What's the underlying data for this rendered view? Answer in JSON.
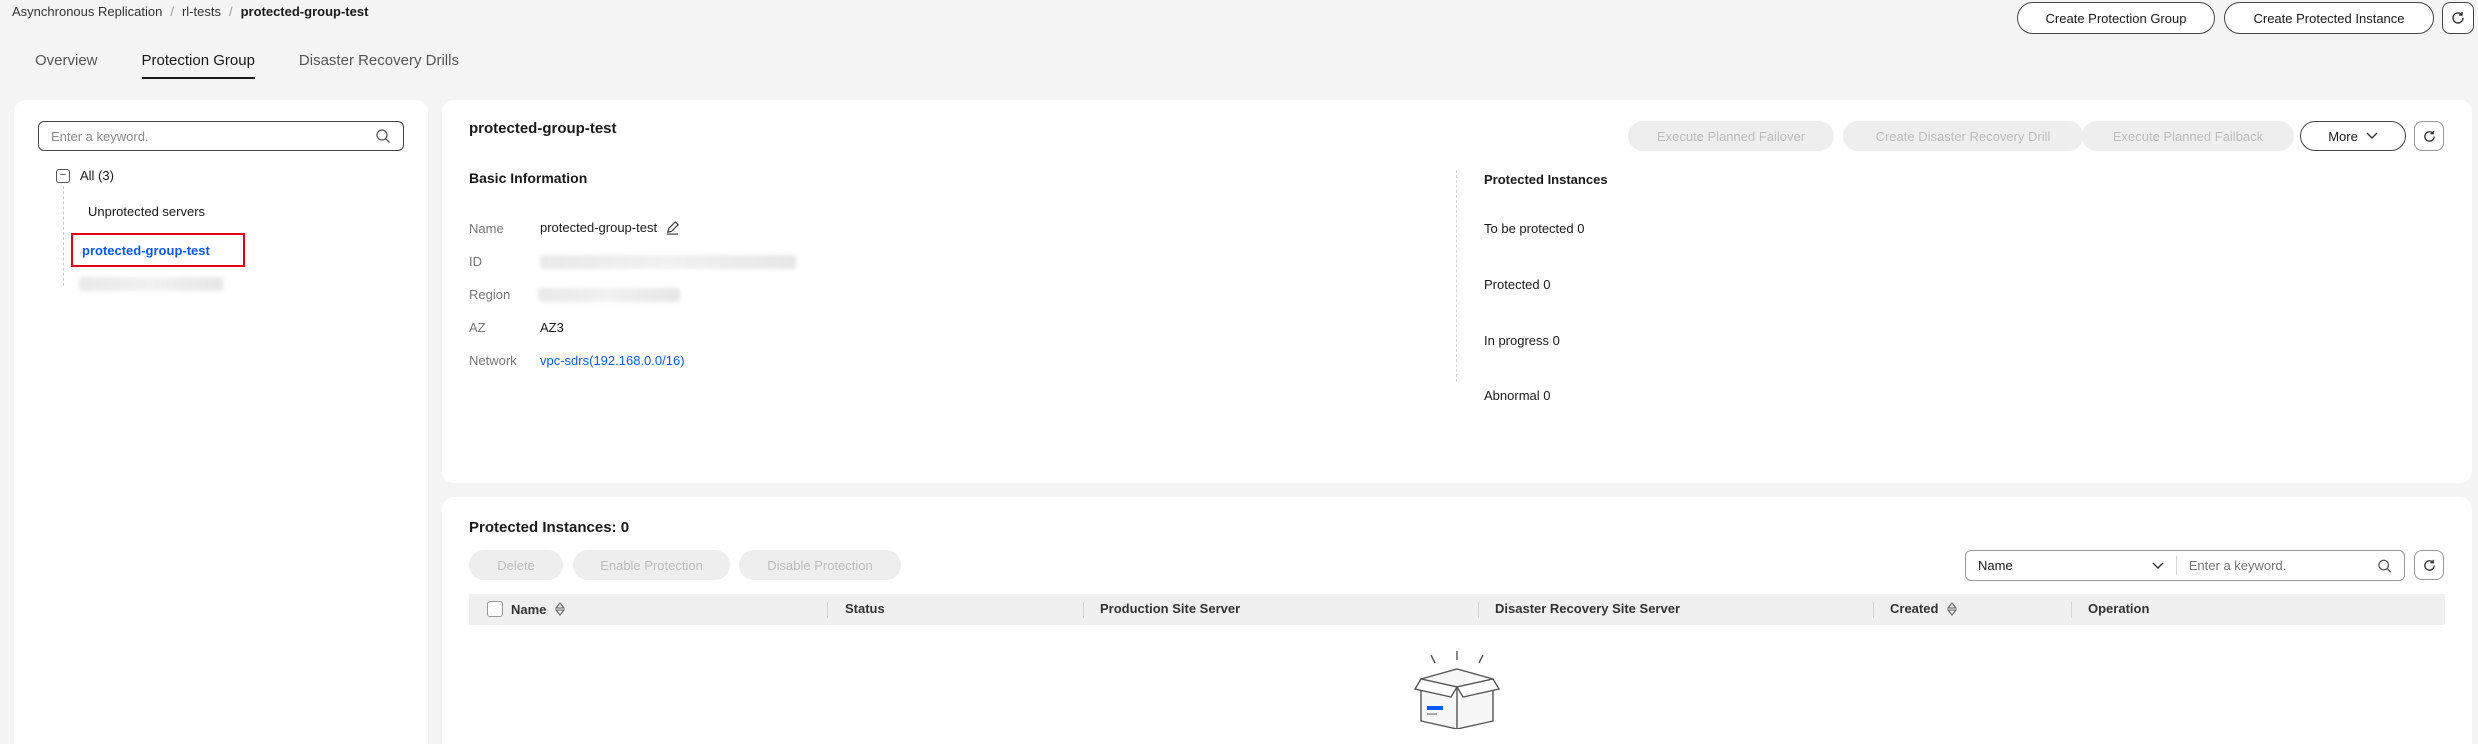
{
  "breadcrumb": {
    "items": [
      "Asynchronous Replication",
      "rl-tests"
    ],
    "current": "protected-group-test"
  },
  "header_actions": {
    "create_group": "Create Protection Group",
    "create_instance": "Create Protected Instance"
  },
  "tabs": [
    "Overview",
    "Protection Group",
    "Disaster Recovery Drills"
  ],
  "sidebar": {
    "search_placeholder": "Enter a keyword.",
    "root_label": "All (3)",
    "items": [
      "Unprotected servers",
      "protected-group-test"
    ]
  },
  "detail": {
    "title": "protected-group-test",
    "actions": {
      "planned_failover": "Execute Planned Failover",
      "dr_drill": "Create Disaster Recovery Drill",
      "planned_failback": "Execute Planned Failback",
      "more": "More"
    },
    "basic_info": {
      "heading": "Basic Information",
      "name_label": "Name",
      "name_value": "protected-group-test",
      "id_label": "ID",
      "region_label": "Region",
      "az_label": "AZ",
      "az_value": "AZ3",
      "network_label": "Network",
      "network_value": "vpc-sdrs(192.168.0.0/16)"
    },
    "protected_instances": {
      "heading": "Protected Instances",
      "to_be_protected": "To be protected 0",
      "protected": "Protected 0",
      "in_progress": "In progress 0",
      "abnormal": "Abnormal 0"
    }
  },
  "instances_panel": {
    "title": "Protected Instances: 0",
    "actions": {
      "delete": "Delete",
      "enable": "Enable Protection",
      "disable": "Disable Protection"
    },
    "filter_select": "Name",
    "search_placeholder": "Enter a keyword.",
    "columns": [
      "Name",
      "Status",
      "Production Site Server",
      "Disaster Recovery Site Server",
      "Created",
      "Operation"
    ]
  },
  "colors": {
    "accent_link": "#0a59f7",
    "highlight_box": "#e3001b"
  }
}
